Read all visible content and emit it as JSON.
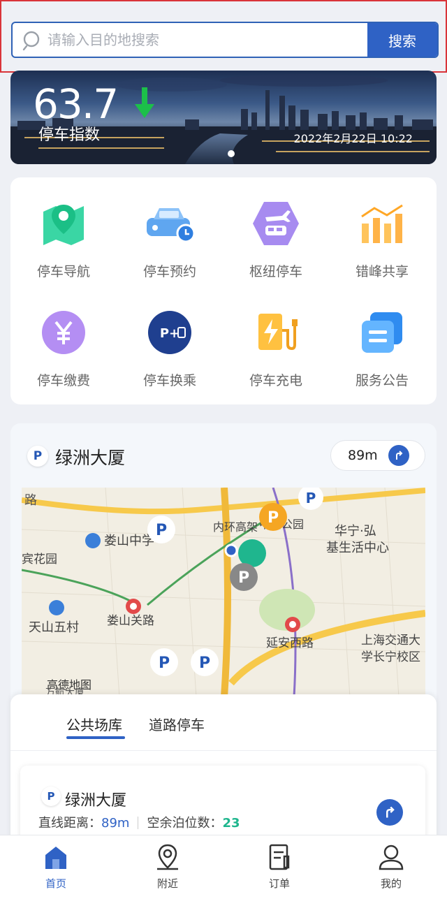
{
  "search": {
    "placeholder": "请输入目的地搜索",
    "button": "搜索"
  },
  "banner": {
    "index_value": "63.7",
    "index_label": "停车指数",
    "date": "2022年2月22日 10:22"
  },
  "services": [
    {
      "label": "停车导航",
      "icon": "map-pin-icon"
    },
    {
      "label": "停车预约",
      "icon": "car-clock-icon"
    },
    {
      "label": "枢纽停车",
      "icon": "plane-train-icon"
    },
    {
      "label": "错峰共享",
      "icon": "bar-chart-icon"
    },
    {
      "label": "停车缴费",
      "icon": "yuan-coin-icon"
    },
    {
      "label": "停车换乘",
      "icon": "park-and-ride-icon"
    },
    {
      "label": "停车充电",
      "icon": "charging-station-icon"
    },
    {
      "label": "服务公告",
      "icon": "notice-icon"
    }
  ],
  "nearby": {
    "badge": "P",
    "name": "绿洲大厦",
    "distance": "89m"
  },
  "map": {
    "labels": [
      "路",
      "娄山中学",
      "内环高架",
      "中山公园",
      "华宁·弘",
      "基生活中心",
      "宾花园",
      "天山五村",
      "娄山关路",
      "延安西路",
      "上海交通大",
      "学长宁校区",
      "高德地图",
      "万航大厦"
    ],
    "markers": [
      "P",
      "P",
      "P",
      "P",
      "P",
      "P"
    ]
  },
  "tabs": {
    "public_garage": "公共场库",
    "road_parking": "道路停车"
  },
  "list": {
    "badge": "P",
    "name": "绿洲大厦",
    "distance_label": "直线距离：",
    "distance_value": "89m",
    "spaces_label": "空余泊位数：",
    "spaces_value": "23"
  },
  "tabbar": [
    {
      "label": "首页",
      "icon": "home-icon",
      "active": true
    },
    {
      "label": "附近",
      "icon": "location-pin-icon"
    },
    {
      "label": "订单",
      "icon": "order-icon"
    },
    {
      "label": "我的",
      "icon": "user-icon"
    }
  ],
  "colors": {
    "primary": "#2f62c5",
    "green": "#1fb68e",
    "highlight": "#d9343a"
  }
}
